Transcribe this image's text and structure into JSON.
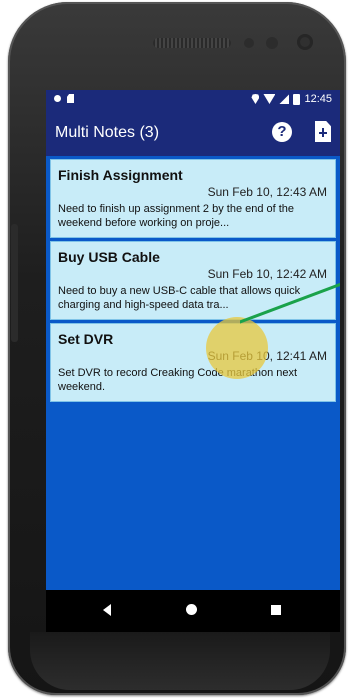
{
  "status_bar": {
    "time": "12:45",
    "icons": [
      "notification-dot-icon",
      "sim-card-icon",
      "location-icon",
      "wifi-icon",
      "signal-icon",
      "battery-icon"
    ]
  },
  "app_bar": {
    "title": "Multi Notes (3)",
    "actions": [
      "help-icon",
      "add-note-icon"
    ]
  },
  "notes": [
    {
      "title": "Finish Assignment",
      "date": "Sun Feb 10, 12:43 AM",
      "text": "Need to finish up assignment 2 by the end of the weekend before working on proje..."
    },
    {
      "title": "Buy USB Cable",
      "date": "Sun Feb 10, 12:42 AM",
      "text": "Need to buy a new USB-C cable that allows quick charging and high-speed data tra..."
    },
    {
      "title": "Set DVR",
      "date": "Sun Feb 10, 12:41 AM",
      "text": "Set DVR to record Creaking Code marathon next weekend."
    }
  ],
  "nav_bar": {
    "icons": [
      "back-icon",
      "home-icon",
      "recents-icon"
    ]
  },
  "colors": {
    "app_bar": "#1b2a7a",
    "screen_background": "#0a59c8",
    "note_card": "#c8ecf8",
    "tap_indicator": "#e8c83c",
    "pointer_line": "#1aa24a"
  }
}
